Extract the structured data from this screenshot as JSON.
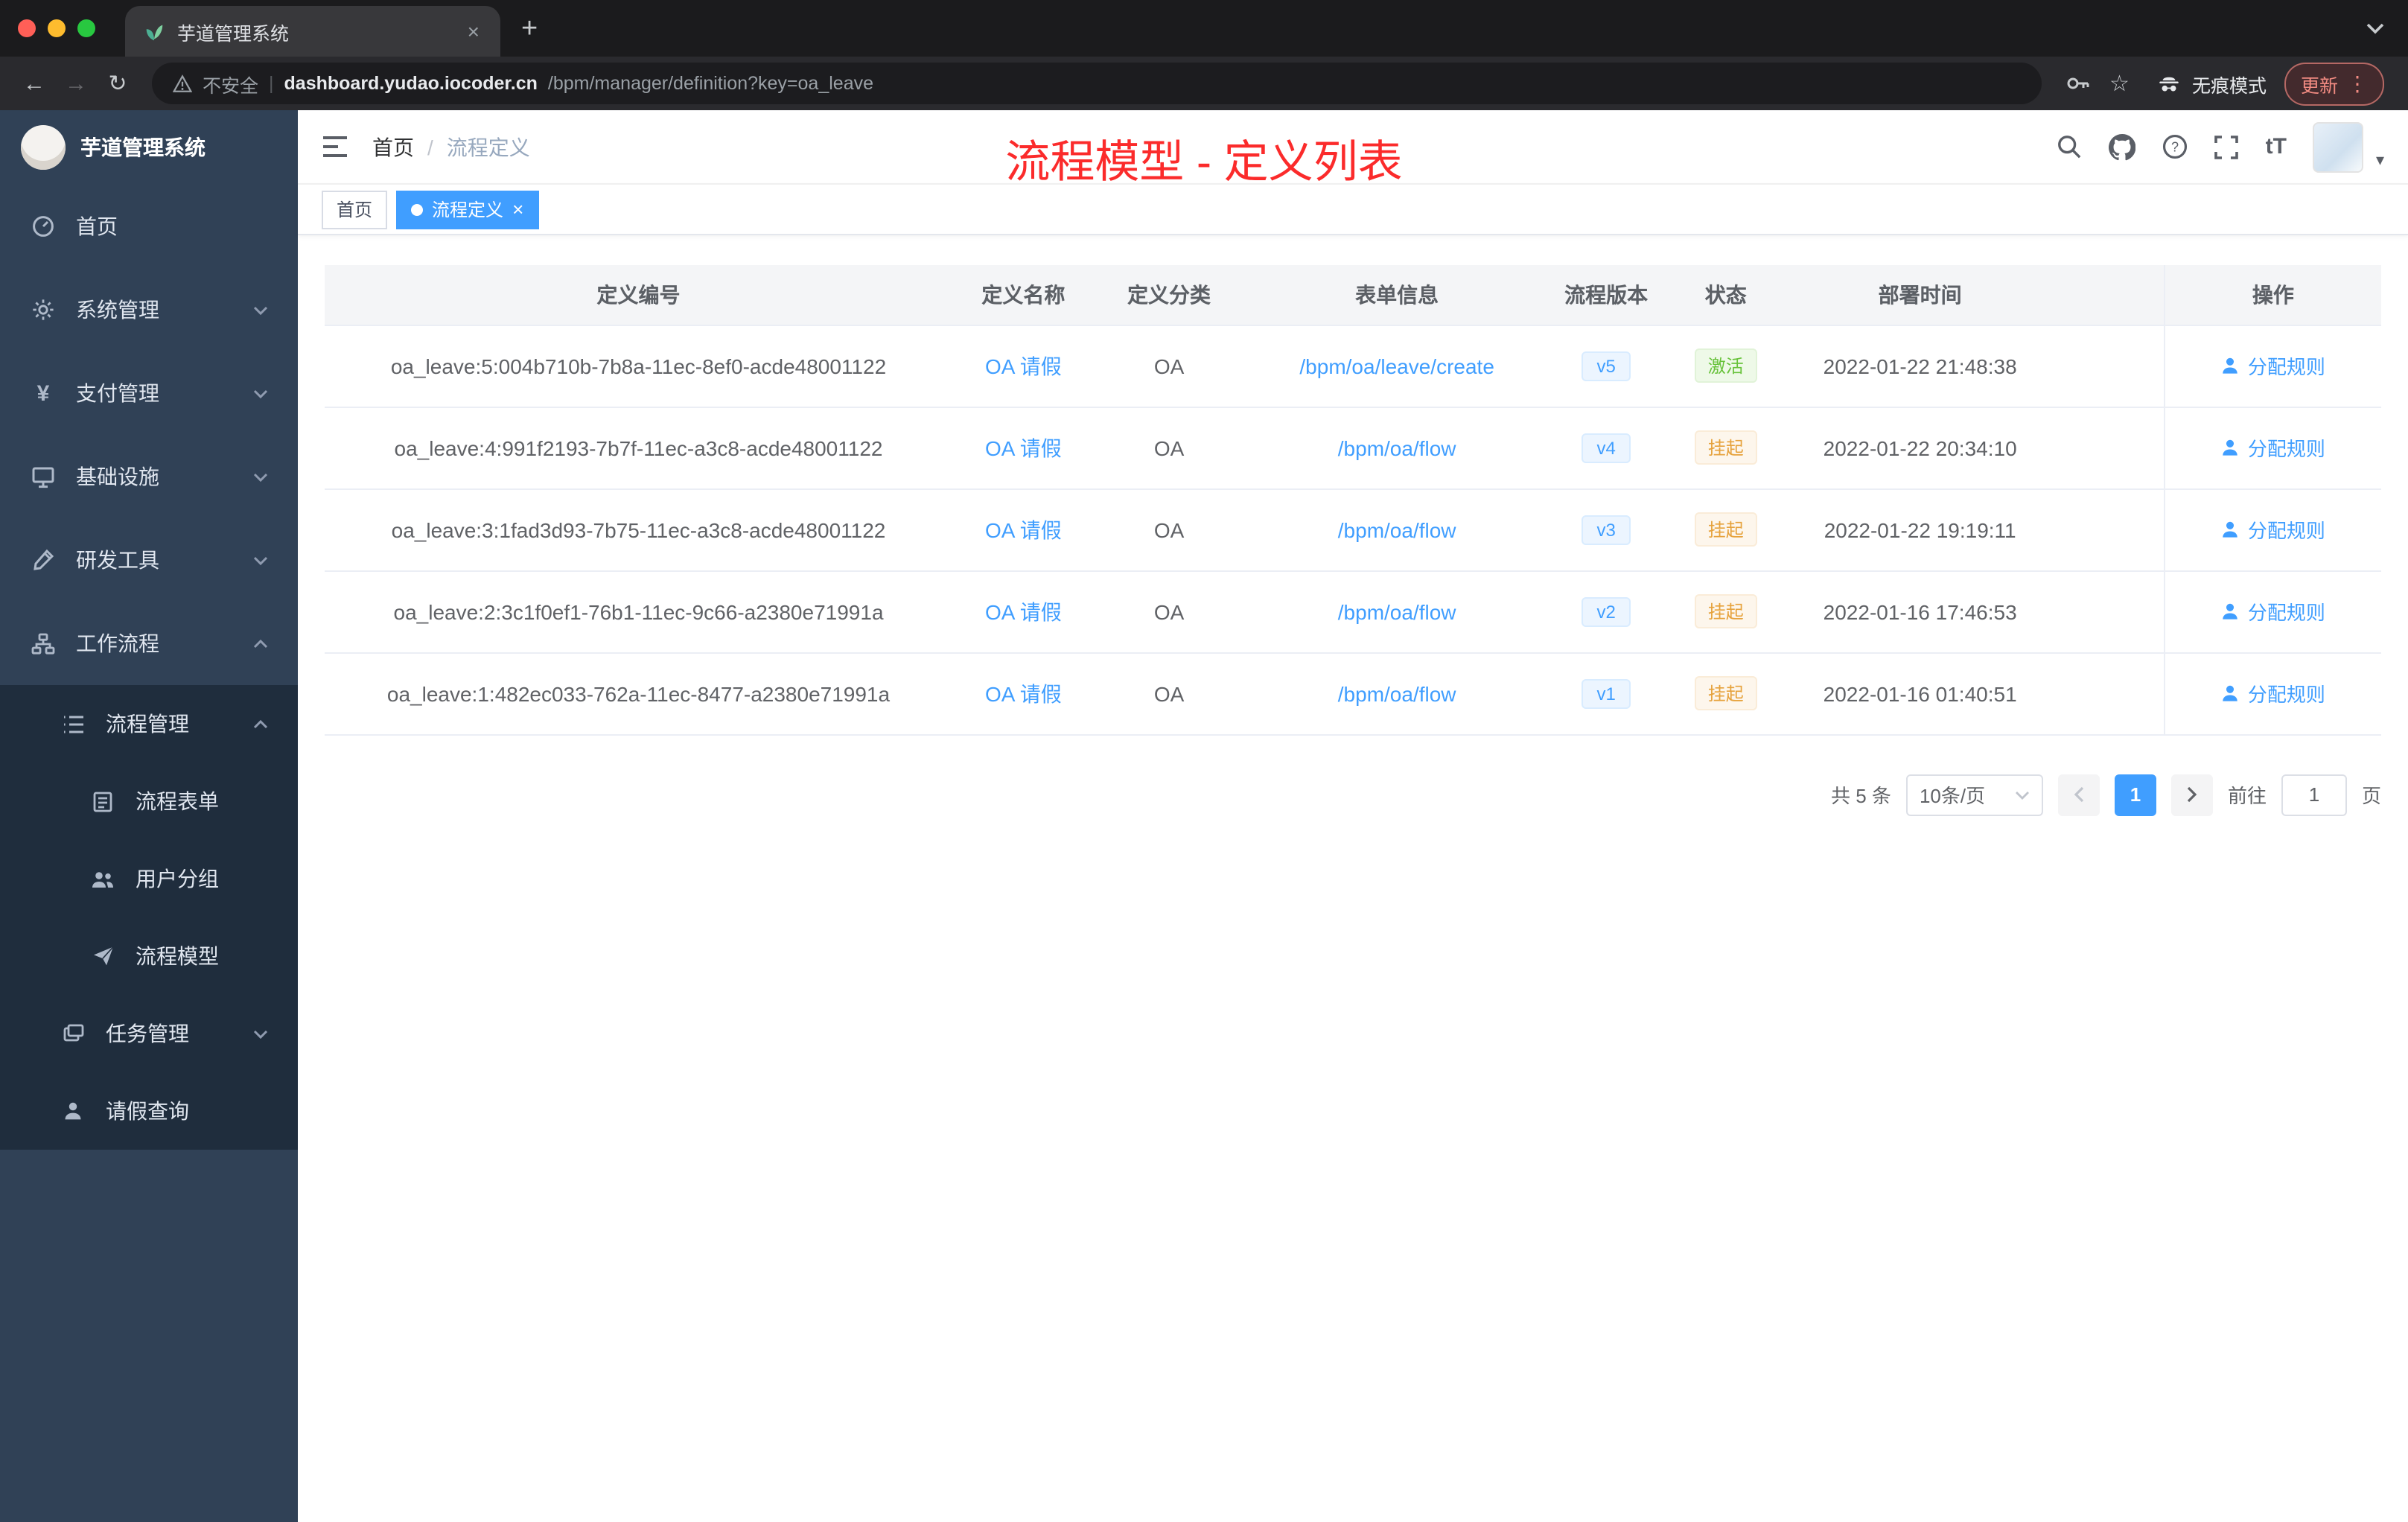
{
  "icons": {
    "close": "×",
    "plus": "+",
    "back": "←",
    "forward": "→",
    "reload": "↻",
    "star": "☆",
    "more": "⋮",
    "caret": "▾",
    "sep": "|"
  },
  "browser": {
    "tab_title": "芋道管理系统",
    "security_label": "不安全",
    "url_host": "dashboard.yudao.iocoder.cn",
    "url_path": "/bpm/manager/definition?key=oa_leave",
    "incognito_label": "无痕模式",
    "update_label": "更新"
  },
  "sidebar": {
    "logo_title": "芋道管理系统",
    "items": [
      {
        "label": "首页"
      },
      {
        "label": "系统管理"
      },
      {
        "label": "支付管理"
      },
      {
        "label": "基础设施"
      },
      {
        "label": "研发工具"
      },
      {
        "label": "工作流程"
      }
    ],
    "workflow_children": [
      {
        "label": "流程管理",
        "level": 2,
        "expanded": true
      },
      {
        "label": "流程表单",
        "level": 3
      },
      {
        "label": "用户分组",
        "level": 3
      },
      {
        "label": "流程模型",
        "level": 3
      },
      {
        "label": "任务管理",
        "level": 2
      },
      {
        "label": "请假查询",
        "level": 2
      }
    ]
  },
  "header": {
    "breadcrumb": [
      "首页",
      "流程定义"
    ],
    "breadcrumb_separator": "/",
    "annotation": "流程模型 - 定义列表",
    "font_icon": "tT"
  },
  "tags": [
    {
      "label": "首页",
      "active": false
    },
    {
      "label": "流程定义",
      "active": true
    }
  ],
  "table": {
    "columns": [
      "定义编号",
      "定义名称",
      "定义分类",
      "表单信息",
      "流程版本",
      "状态",
      "部署时间",
      "操作"
    ],
    "action_label": "分配规则",
    "rows": [
      {
        "id": "oa_leave:5:004b710b-7b8a-11ec-8ef0-acde48001122",
        "name": "OA 请假",
        "category": "OA",
        "form": "/bpm/oa/leave/create",
        "version": "v5",
        "status": "激活",
        "status_type": "success",
        "deploy_time": "2022-01-22 21:48:38"
      },
      {
        "id": "oa_leave:4:991f2193-7b7f-11ec-a3c8-acde48001122",
        "name": "OA 请假",
        "category": "OA",
        "form": "/bpm/oa/flow",
        "version": "v4",
        "status": "挂起",
        "status_type": "warning",
        "deploy_time": "2022-01-22 20:34:10"
      },
      {
        "id": "oa_leave:3:1fad3d93-7b75-11ec-a3c8-acde48001122",
        "name": "OA 请假",
        "category": "OA",
        "form": "/bpm/oa/flow",
        "version": "v3",
        "status": "挂起",
        "status_type": "warning",
        "deploy_time": "2022-01-22 19:19:11"
      },
      {
        "id": "oa_leave:2:3c1f0ef1-76b1-11ec-9c66-a2380e71991a",
        "name": "OA 请假",
        "category": "OA",
        "form": "/bpm/oa/flow",
        "version": "v2",
        "status": "挂起",
        "status_type": "warning",
        "deploy_time": "2022-01-16 17:46:53"
      },
      {
        "id": "oa_leave:1:482ec033-762a-11ec-8477-a2380e71991a",
        "name": "OA 请假",
        "category": "OA",
        "form": "/bpm/oa/flow",
        "version": "v1",
        "status": "挂起",
        "status_type": "warning",
        "deploy_time": "2022-01-16 01:40:51"
      }
    ]
  },
  "pagination": {
    "total": "共 5 条",
    "page_size": "10条/页",
    "current_page": "1",
    "goto_label": "前往",
    "goto_value": "1",
    "page_unit": "页"
  },
  "colors": {
    "accent_blue": "#409eff",
    "success_green": "#67c23a",
    "warning_orange": "#e6a23c",
    "annotation_red": "#fb2b2b",
    "sidebar_bg": "#304156",
    "submenu_bg": "#1f2d3d"
  }
}
